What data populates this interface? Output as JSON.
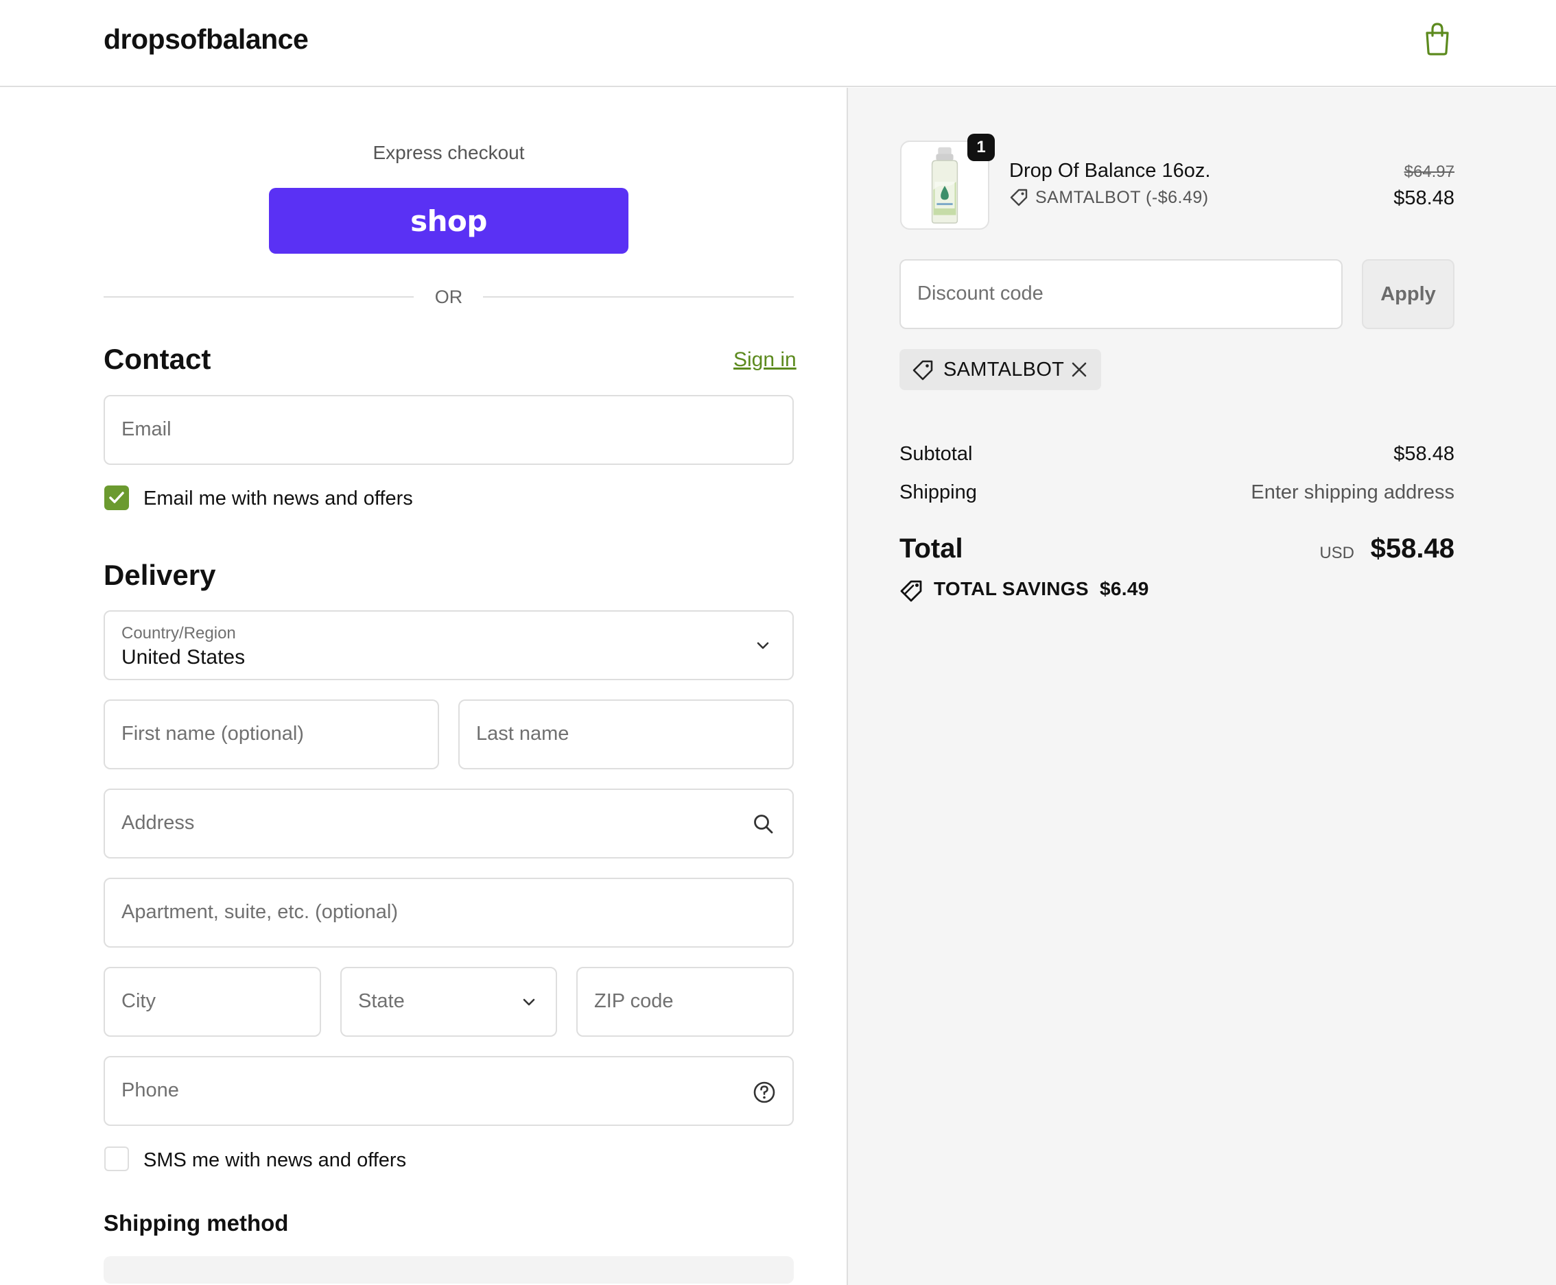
{
  "header": {
    "logo": "dropsofbalance"
  },
  "express": {
    "title": "Express checkout",
    "shop_label": "shop",
    "or_label": "OR"
  },
  "contact": {
    "title": "Contact",
    "sign_in": "Sign in",
    "email_placeholder": "Email",
    "news_label": "Email me with news and offers",
    "news_checked": true
  },
  "delivery": {
    "title": "Delivery",
    "country_label": "Country/Region",
    "country_value": "United States",
    "first_name_placeholder": "First name (optional)",
    "last_name_placeholder": "Last name",
    "address_placeholder": "Address",
    "apartment_placeholder": "Apartment, suite, etc. (optional)",
    "city_placeholder": "City",
    "state_placeholder": "State",
    "zip_placeholder": "ZIP code",
    "phone_placeholder": "Phone",
    "sms_label": "SMS me with news and offers",
    "sms_checked": false
  },
  "shipping_method": {
    "title": "Shipping method"
  },
  "order": {
    "quantity": "1",
    "product_name": "Drop Of Balance 16oz.",
    "product_discount": "SAMTALBOT (-$6.49)",
    "original_price": "$64.97",
    "price": "$58.48",
    "discount_placeholder": "Discount code",
    "apply_label": "Apply",
    "applied_code": "SAMTALBOT",
    "subtotal_label": "Subtotal",
    "subtotal_value": "$58.48",
    "shipping_label": "Shipping",
    "shipping_value": "Enter shipping address",
    "total_label": "Total",
    "currency": "USD",
    "total_value": "$58.48",
    "savings_label": "TOTAL SAVINGS",
    "savings_value": "$6.49"
  },
  "colors": {
    "shop_purple": "#5a31f4",
    "accent_green": "#6b9a2f"
  }
}
